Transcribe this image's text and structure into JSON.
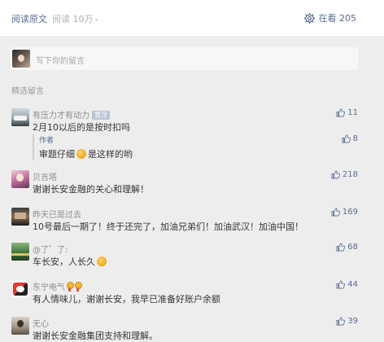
{
  "topbar": {
    "read_original": "阅读原文",
    "read_count": "阅读 10万",
    "read_count_chevron": "›",
    "looking_label": "在看 205",
    "looking_icon": "looking-flower-icon"
  },
  "comment_box": {
    "placeholder": "写下你的留言"
  },
  "section_title": "精选留言",
  "comments": [
    {
      "nickname": "有压力才有动力",
      "badge": "置顶",
      "text": "2月10以后的是按时扣吗",
      "likes": "11",
      "reply": {
        "author": "作者",
        "text": "审题仔细",
        "text_tail": "是这样的哟",
        "likes": "8"
      }
    },
    {
      "nickname": "贝吉塔",
      "text": "谢谢长安金融的关心和理解！",
      "likes": "218"
    },
    {
      "nickname": "昨天已是过去",
      "text": "10号最后一期了！终于还完了，加油兄弟们！加油武汉！加油中国！",
      "likes": "169"
    },
    {
      "nickname": "@了゛了:",
      "text": "车长安，人长久",
      "likes": "68"
    },
    {
      "nickname": "东宁电气",
      "text": "有人情味儿，谢谢长安，我早已准备好账户余额",
      "likes": "44"
    },
    {
      "nickname": "无心",
      "text": "谢谢长安金融集团支持和理解。",
      "likes": "39"
    }
  ],
  "colors": {
    "link": "#576b95",
    "background": "#ededed",
    "text": "#353535",
    "muted": "#8c8c8c"
  }
}
